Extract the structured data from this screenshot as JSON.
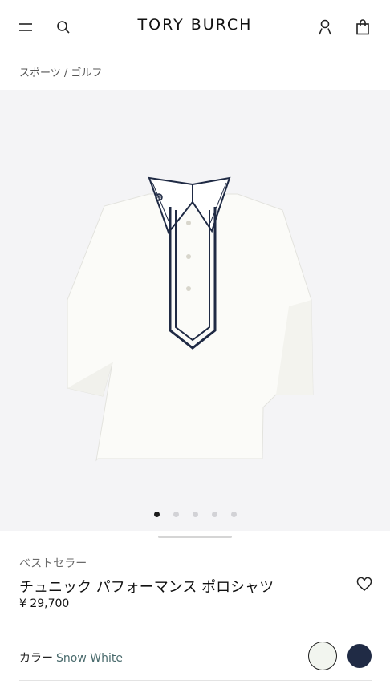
{
  "header": {
    "brand": "TORY BURCH",
    "menu_icon": "hamburger-menu-icon",
    "search_icon": "search-icon",
    "account_icon": "user-icon",
    "bag_icon": "shopping-bag-icon"
  },
  "breadcrumb": {
    "items": [
      "スポーツ",
      "ゴルフ"
    ],
    "separator": " / "
  },
  "gallery": {
    "image_subject": "white polo shirt with navy trim",
    "image_count": 5,
    "active_index": 0
  },
  "product": {
    "badge": "ベストセラー",
    "title": "チュニック パフォーマンス ポロシャツ",
    "price": "¥ 29,700",
    "wishlist_icon": "heart-icon"
  },
  "color": {
    "label": "カラー",
    "selected": "Snow White",
    "swatches": [
      {
        "name": "Snow White",
        "hex": "#f2f5ef",
        "selected": true
      },
      {
        "name": "Navy",
        "hex": "#202b45",
        "selected": false
      }
    ]
  },
  "colors": {
    "navy_trim": "#1f2a44",
    "gallery_bg": "#f4f4f6",
    "accent_text": "#4a6b6d"
  }
}
